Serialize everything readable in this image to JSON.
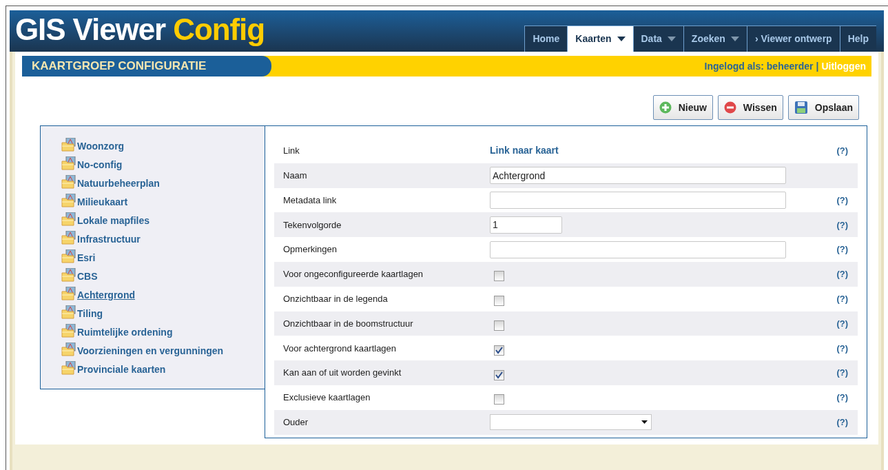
{
  "header": {
    "title": "GIS Viewer",
    "title_accent": "Config"
  },
  "nav": [
    {
      "label": "Home",
      "selected": false,
      "dropdown": false
    },
    {
      "label": "Kaarten",
      "selected": true,
      "dropdown": true
    },
    {
      "label": "Data",
      "selected": false,
      "dropdown": true
    },
    {
      "label": "Zoeken",
      "selected": false,
      "dropdown": true
    },
    {
      "label": "› Viewer ontwerp",
      "selected": false,
      "dropdown": false
    },
    {
      "label": "Help",
      "selected": false,
      "dropdown": false
    }
  ],
  "page_title": "KAARTGROEP CONFIGURATIE",
  "login": {
    "text": "Ingelogd als: beheerder",
    "separator": "|",
    "logout": "Uitloggen"
  },
  "buttons": [
    {
      "label": "Nieuw",
      "kind": "new"
    },
    {
      "label": "Wissen",
      "kind": "delete"
    },
    {
      "label": "Opslaan",
      "kind": "save"
    }
  ],
  "tree": [
    {
      "label": "Woonzorg",
      "selected": false
    },
    {
      "label": "No-config",
      "selected": false
    },
    {
      "label": "Natuurbeheerplan",
      "selected": false
    },
    {
      "label": "Milieukaart",
      "selected": false
    },
    {
      "label": "Lokale mapfiles",
      "selected": false
    },
    {
      "label": "Infrastructuur",
      "selected": false
    },
    {
      "label": "Esri",
      "selected": false
    },
    {
      "label": "CBS",
      "selected": false
    },
    {
      "label": "Achtergrond",
      "selected": true
    },
    {
      "label": "Tiling",
      "selected": false
    },
    {
      "label": "Ruimtelijke ordening",
      "selected": false
    },
    {
      "label": "Voorzieningen en vergunningen",
      "selected": false
    },
    {
      "label": "Provinciale kaarten",
      "selected": false
    }
  ],
  "form": [
    {
      "label": "Link",
      "kind": "link",
      "value": "Link naar kaart",
      "help": "(?)"
    },
    {
      "label": "Naam",
      "kind": "text",
      "value": "Achtergrond"
    },
    {
      "label": "Metadata link",
      "kind": "text",
      "help": "(?)"
    },
    {
      "label": "Tekenvolgorde",
      "kind": "short",
      "value": "1",
      "help": "(?)"
    },
    {
      "label": "Opmerkingen",
      "kind": "text",
      "help": "(?)"
    },
    {
      "label": "Voor ongeconfigureerde kaartlagen",
      "kind": "checkbox",
      "checked": false,
      "help": "(?)"
    },
    {
      "label": "Onzichtbaar in de legenda",
      "kind": "checkbox",
      "checked": false,
      "help": "(?)"
    },
    {
      "label": "Onzichtbaar in de boomstructuur",
      "kind": "checkbox",
      "checked": false,
      "help": "(?)"
    },
    {
      "label": "Voor achtergrond kaartlagen",
      "kind": "checkbox",
      "checked": true,
      "help": "(?)"
    },
    {
      "label": "Kan aan of uit worden gevinkt",
      "kind": "checkbox",
      "checked": true,
      "help": "(?)"
    },
    {
      "label": "Exclusieve kaartlagen",
      "kind": "checkbox",
      "checked": false,
      "help": "(?)"
    },
    {
      "label": "Ouder",
      "kind": "select",
      "help": "(?)"
    }
  ]
}
